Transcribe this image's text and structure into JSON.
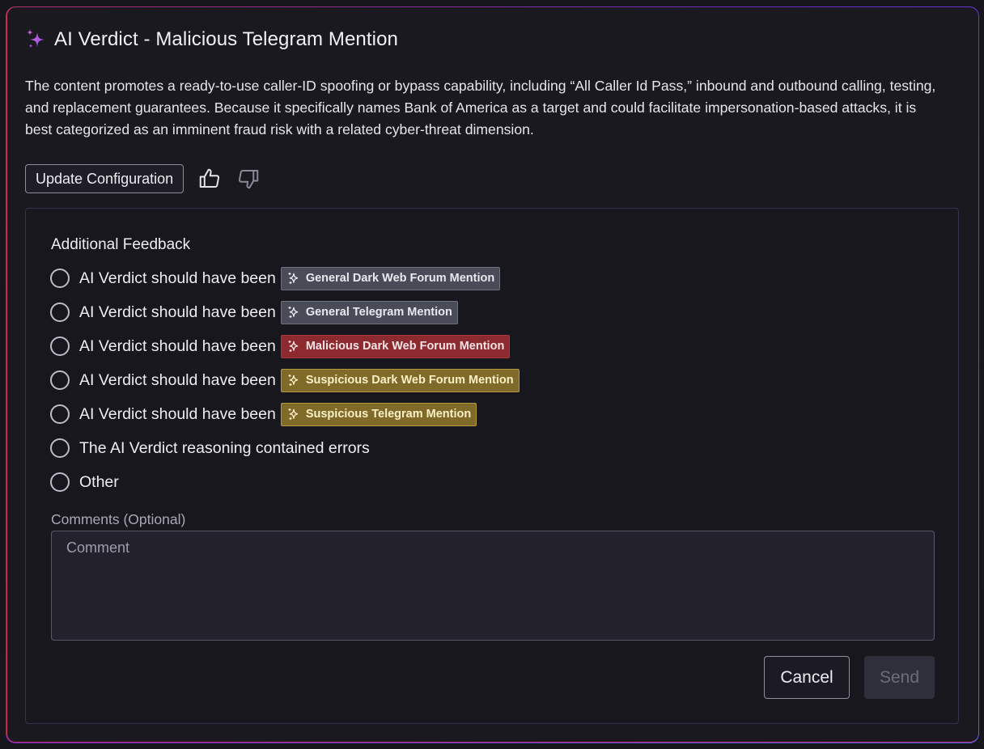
{
  "header": {
    "title": "AI Verdict - Malicious Telegram Mention",
    "icon": "sparkle-icon"
  },
  "description": "The content promotes a ready-to-use caller-ID spoofing or bypass capability, including “All Caller Id Pass,” inbound and outbound calling, testing, and replacement guarantees. Because it specifically names Bank of America as a target and could facilitate impersonation-based attacks, it is best categorized as an imminent fraud risk with a related cyber-threat dimension.",
  "actions": {
    "update_label": "Update Configuration",
    "thumbs_up": "thumbs-up-icon",
    "thumbs_down": "thumbs-down-icon"
  },
  "feedback": {
    "title": "Additional Feedback",
    "option_prefix": "AI Verdict should have been",
    "options": [
      {
        "badge": "General Dark Web Forum Mention",
        "variant": "gray"
      },
      {
        "badge": "General Telegram Mention",
        "variant": "gray"
      },
      {
        "badge": "Malicious Dark Web Forum Mention",
        "variant": "red"
      },
      {
        "badge": "Suspicious Dark Web Forum Mention",
        "variant": "yellow"
      },
      {
        "badge": "Suspicious Telegram Mention",
        "variant": "yellow"
      }
    ],
    "reasoning_option": "The AI Verdict reasoning contained errors",
    "other_option": "Other",
    "comments_label": "Comments (Optional)",
    "comments_placeholder": "Comment",
    "cancel_label": "Cancel",
    "send_label": "Send"
  },
  "colors": {
    "gray_badge": "#4a4b58",
    "red_badge": "#8c2a30",
    "yellow_badge": "#7f6a2a",
    "sparkle": "#b455e0"
  }
}
